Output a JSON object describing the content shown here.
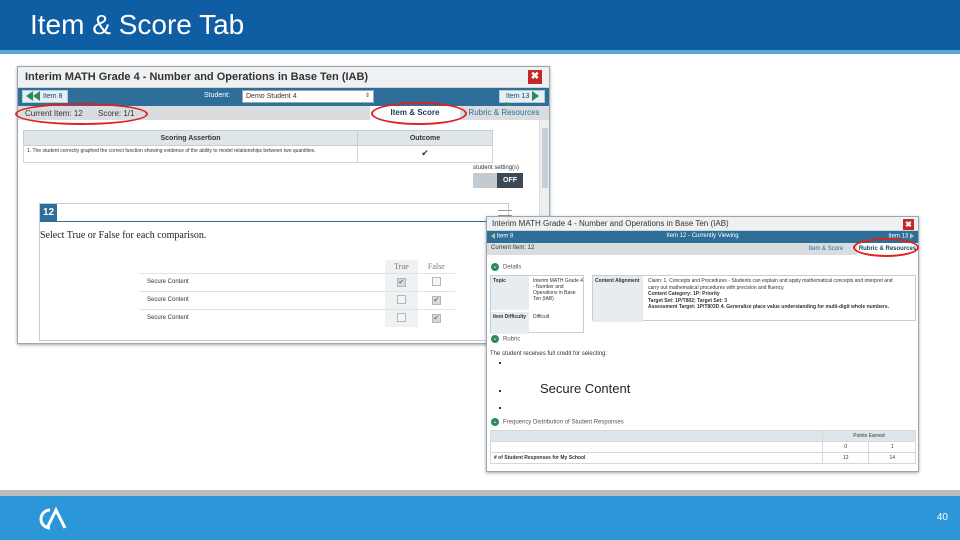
{
  "slide": {
    "title": "Item & Score Tab",
    "page_number": "40",
    "colors": {
      "header": "#0f5ea3",
      "footer": "#2b97d8",
      "highlight_ring": "#e01f1f"
    },
    "logo": "CA-logo-icon"
  },
  "window1": {
    "title": "Interim MATH Grade 4 - Number and Operations in Base Ten (IAB)",
    "close": "✖",
    "prev_item": "Item 8",
    "student_label": "Student:",
    "student_value": "Demo Student 4",
    "next_item": "Item 13",
    "current_item": "Current Item: 12",
    "score": "Score: 1/1",
    "tabs": [
      "Item & Score",
      "Rubric & Resources"
    ],
    "table": {
      "headers": [
        "Scoring Assertion",
        "Outcome"
      ],
      "row_text": "1. The student correctly graphed the correct function showing evidence of the ability to model relationships between two quantities.",
      "row_outcome": "✔"
    },
    "settings_label": "student setting(s)",
    "toggle": "OFF",
    "item_number": "12",
    "prompt": "Select True or False for each comparison.",
    "tf_headers": [
      "True",
      "False"
    ],
    "tf_rows": [
      {
        "label": "Secure Content",
        "true": "✔",
        "false": ""
      },
      {
        "label": "Secure Content",
        "true": "",
        "false": "✔"
      },
      {
        "label": "Secure Content",
        "true": "",
        "false": "✔"
      }
    ]
  },
  "window2": {
    "title": "Interim MATH Grade 4 - Number and Operations in Base Ten (IAB)",
    "close": "✖",
    "prev_item": "Item 8",
    "viewing": "Item 12 - Currently Viewing",
    "next_item": "Item 13",
    "current_item": "Current Item: 12",
    "tabs": [
      "Item & Score",
      "Rubric & Resources"
    ],
    "details_label": "Details",
    "details": {
      "topic_label": "Topic",
      "topic_value": "Interim MATH Grade 4 - Number and Operations in Base Ten (IAB)",
      "difficulty_label": "Item Difficulty",
      "difficulty_value": "Difficult",
      "alignment_label": "Content Alignment",
      "alignment_lines": [
        "Claim: 1. Concepts and Procedures - Students can explain and apply mathematical concepts and interpret and",
        "carry out mathematical procedures with precision and fluency.",
        "Content Category: 1P: Priority",
        "Target Set: 1P/T802; Target Set: 3",
        "Assessment Target: 1P/T803D 4. Generalize place value understanding for multi-digit whole numbers."
      ]
    },
    "rubric_label": "Rubric",
    "rubric_text": "The student receives full credit for selecting:",
    "secure_content": "Secure Content",
    "freq_label": "Frequency Distribution of Student Responses",
    "freq": {
      "header": "Points Earned",
      "points": [
        "0",
        "1"
      ],
      "row_label": "# of Student Responses for My School",
      "counts": [
        "12",
        "14"
      ]
    }
  }
}
